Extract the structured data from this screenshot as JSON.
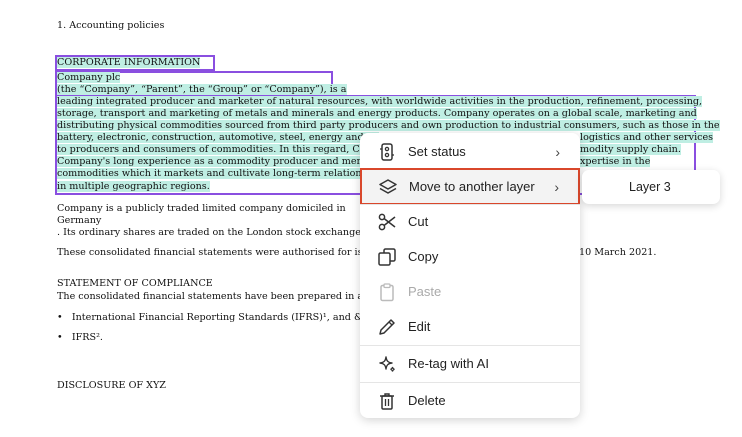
{
  "document": {
    "section_heading": "1. Accounting policies",
    "corporate_heading": "CORPORATE INFORMATION",
    "company_name": "Company plc",
    "company_aliases": "(the “Company”, “Parent”, the “Group” or “Company”), is a",
    "para_lines": [
      "leading integrated producer and marketer of natural resources, with worldwide activities in the production, refinement, processing,",
      "storage, transport and marketing of metals and minerals and energy products. Company operates on a global scale, marketing and",
      "distributing physical commodities sourced from third party producers and own production to industrial consumers, such as those in the",
      "battery, electronic, construction, automotive, steel, energy and oil",
      "to producers and consumers of commodities. In this regard, Comp",
      "Company's long experience as a commodity producer and mercha",
      "commodities which it markets and cultivate long-term relationship",
      "in multiple geographic regions."
    ],
    "para_tails": [
      "logistics and other services",
      "modity supply chain.",
      "xpertise in the"
    ],
    "domicile_line1": "Company is a publicly traded limited company domiciled in",
    "domicile_line2": "Germany",
    "domicile_line3": ". Its ordinary shares are traded on the London stock exchanges.",
    "authorised_line_start": "These consolidated financial statements were authorised for issue",
    "authorised_line_end": "10 March 2021.",
    "compliance_heading": "STATEMENT OF COMPLIANCE",
    "compliance_text": "The consolidated financial statements have been prepared in acco",
    "bullet1": "International Financial Reporting Standards (IFRS)¹, and & < >",
    "bullet2": "IFRS².",
    "bullet_mark": "•",
    "disclosure_heading": "DISCLOSURE OF XYZ"
  },
  "context_menu": {
    "items": [
      {
        "label": "Set status",
        "icon": "status-icon",
        "has_submenu": true
      },
      {
        "label": "Move to another layer",
        "icon": "layers-icon",
        "has_submenu": true,
        "active": true
      },
      {
        "label": "Cut",
        "icon": "scissors-icon"
      },
      {
        "label": "Copy",
        "icon": "copy-icon"
      },
      {
        "label": "Paste",
        "icon": "clipboard-icon",
        "disabled": true
      },
      {
        "label": "Edit",
        "icon": "pencil-icon"
      },
      {
        "label": "Re-tag with AI",
        "icon": "sparkle-icon"
      },
      {
        "label": "Delete",
        "icon": "trash-icon"
      }
    ],
    "chevron": "›"
  },
  "submenu": {
    "items": [
      {
        "label": "Layer 3"
      }
    ]
  },
  "colors": {
    "highlight": "#bfeee3",
    "selection_border": "#8a4fe0",
    "active_outline": "#d9472b"
  }
}
